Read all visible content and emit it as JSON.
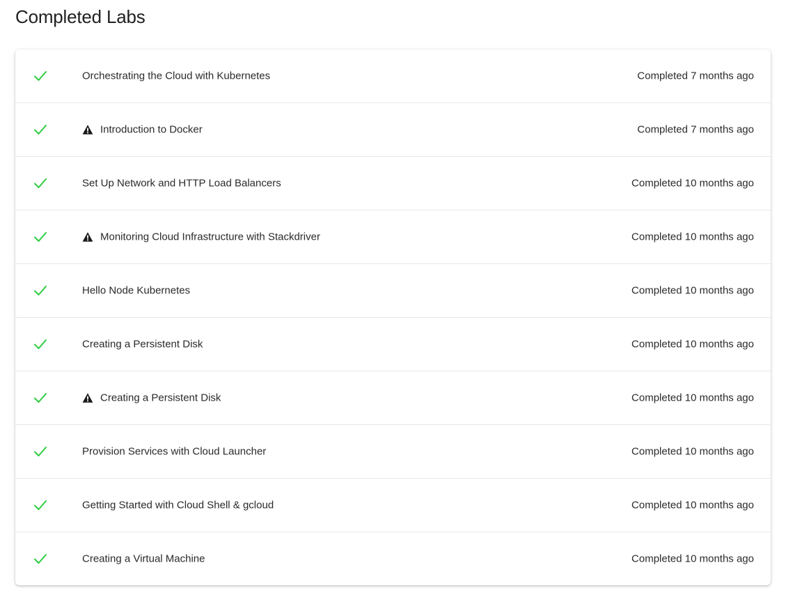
{
  "page": {
    "title": "Completed Labs"
  },
  "colors": {
    "check": "#2ecc40",
    "warning": "#1a1a1a"
  },
  "labs": [
    {
      "title": "Orchestrating the Cloud with Kubernetes",
      "status": "Completed 7 months ago",
      "warning": false
    },
    {
      "title": "Introduction to Docker",
      "status": "Completed 7 months ago",
      "warning": true
    },
    {
      "title": "Set Up Network and HTTP Load Balancers",
      "status": "Completed 10 months ago",
      "warning": false
    },
    {
      "title": "Monitoring Cloud Infrastructure with Stackdriver",
      "status": "Completed 10 months ago",
      "warning": true
    },
    {
      "title": "Hello Node Kubernetes",
      "status": "Completed 10 months ago",
      "warning": false
    },
    {
      "title": "Creating a Persistent Disk",
      "status": "Completed 10 months ago",
      "warning": false
    },
    {
      "title": "Creating a Persistent Disk",
      "status": "Completed 10 months ago",
      "warning": true
    },
    {
      "title": "Provision Services with Cloud Launcher",
      "status": "Completed 10 months ago",
      "warning": false
    },
    {
      "title": "Getting Started with Cloud Shell & gcloud",
      "status": "Completed 10 months ago",
      "warning": false
    },
    {
      "title": "Creating a Virtual Machine",
      "status": "Completed 10 months ago",
      "warning": false
    }
  ]
}
